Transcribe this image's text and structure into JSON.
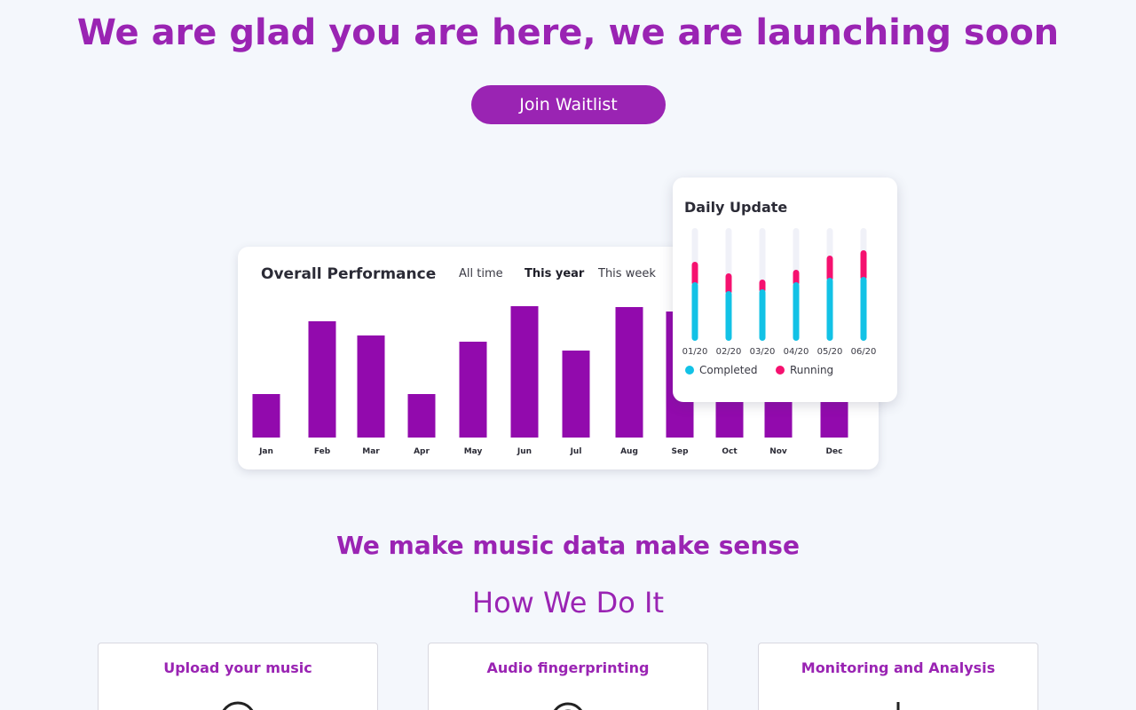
{
  "hero": {
    "title": "We are glad you are here, we are launching soon",
    "join_label": "Join Waitlist"
  },
  "performance": {
    "title": "Overall Performance",
    "tabs": [
      "All time",
      "This year",
      "This week"
    ],
    "active_tab": "This year"
  },
  "daily": {
    "title": "Daily Update",
    "legend": [
      "Completed",
      "Running"
    ]
  },
  "tagline": "We make music data make sense",
  "how": {
    "title": "How We Do It",
    "features": [
      {
        "title": "Upload your music",
        "icon": "upload-icon"
      },
      {
        "title": "Audio fingerprinting",
        "icon": "fingerprint-icon"
      },
      {
        "title": "Monitoring and Analysis",
        "icon": "monitor-icon"
      }
    ]
  },
  "colors": {
    "brand": "#9a24b3",
    "bar": "#920aad",
    "completed": "#12c2e6",
    "running": "#f5116f",
    "track": "#f0f1f8"
  },
  "chart_data": [
    {
      "type": "bar",
      "title": "Overall Performance",
      "categories": [
        "Jan",
        "Feb",
        "Mar",
        "Apr",
        "May",
        "Jun",
        "Jul",
        "Aug",
        "Sep",
        "Oct",
        "Nov",
        "Dec"
      ],
      "values": [
        49,
        131,
        115,
        49,
        108,
        148,
        98,
        147,
        142,
        85,
        72,
        80
      ],
      "ylim": [
        0,
        160
      ],
      "grid": false
    },
    {
      "type": "bar",
      "title": "Daily Update",
      "categories": [
        "01/20",
        "02/20",
        "03/20",
        "04/20",
        "05/20",
        "06/20"
      ],
      "series": [
        {
          "name": "Completed",
          "values": [
            66,
            56,
            58,
            66,
            71,
            72
          ]
        },
        {
          "name": "Running",
          "values": [
            23,
            20,
            11,
            14,
            25,
            30
          ]
        }
      ],
      "stacked": true,
      "ylim": [
        0,
        127
      ],
      "legend_position": "bottom"
    }
  ]
}
